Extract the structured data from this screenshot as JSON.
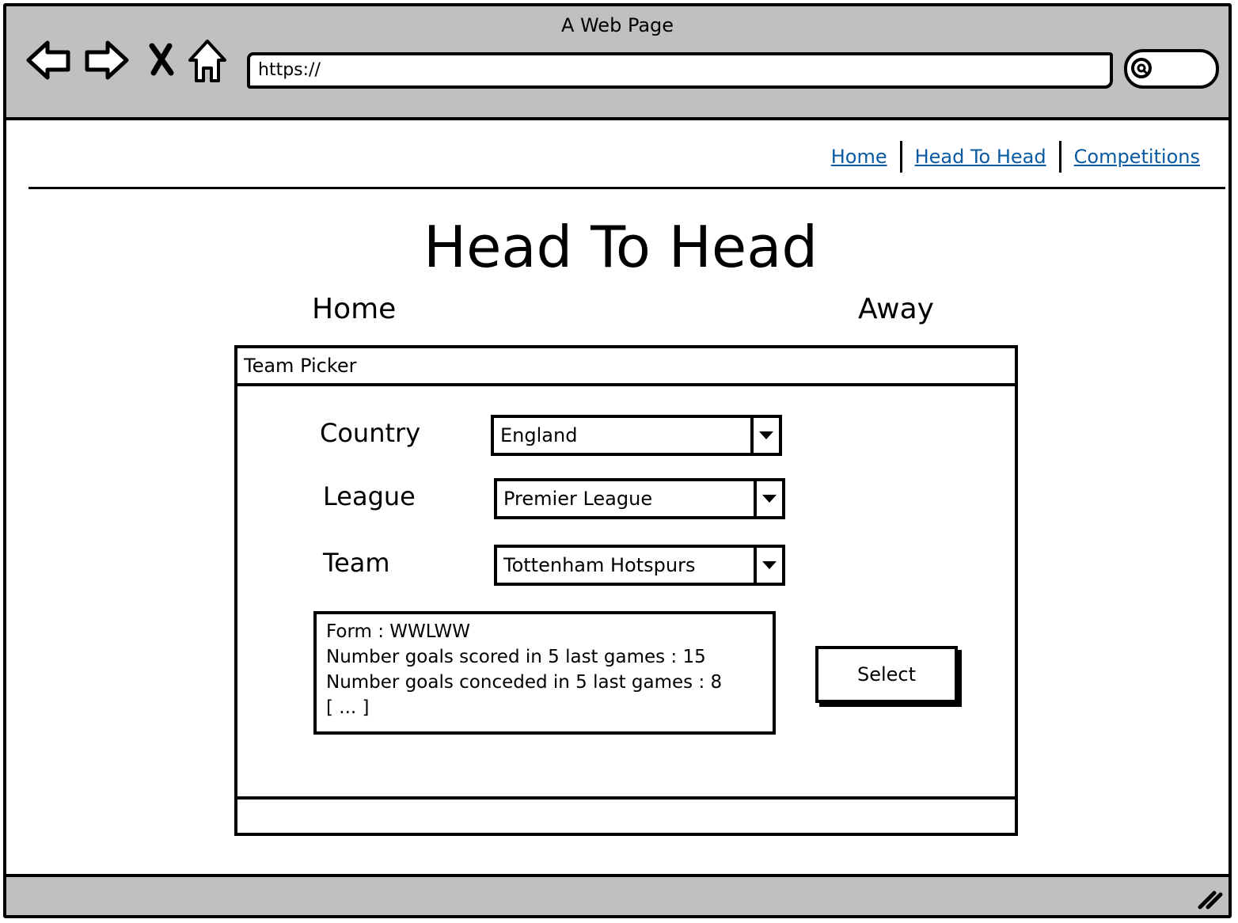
{
  "browser": {
    "window_title": "A Web Page",
    "url": "https://",
    "icons": [
      "back-arrow-icon",
      "forward-arrow-icon",
      "close-x-icon",
      "home-icon",
      "search-icon",
      "resize-grip-icon"
    ]
  },
  "nav": {
    "links": [
      "Home",
      "Head To Head",
      "Competitions"
    ],
    "link_color": "#0a5aa3"
  },
  "page": {
    "title": "Head To Head",
    "home_label": "Home",
    "away_label": "Away"
  },
  "picker": {
    "title": "Team Picker",
    "country_label": "Country",
    "country_value": "England",
    "league_label": "League",
    "league_value": "Premier League",
    "team_label": "Team",
    "team_value": "Tottenham Hotspurs",
    "info_lines": [
      "Form : WWLWW",
      "Number goals scored in 5 last games : 15",
      "Number goals conceded in 5 last games : 8",
      "[ ... ]"
    ],
    "select_label": "Select"
  },
  "colors": {
    "chrome": "#c0c0c0"
  }
}
